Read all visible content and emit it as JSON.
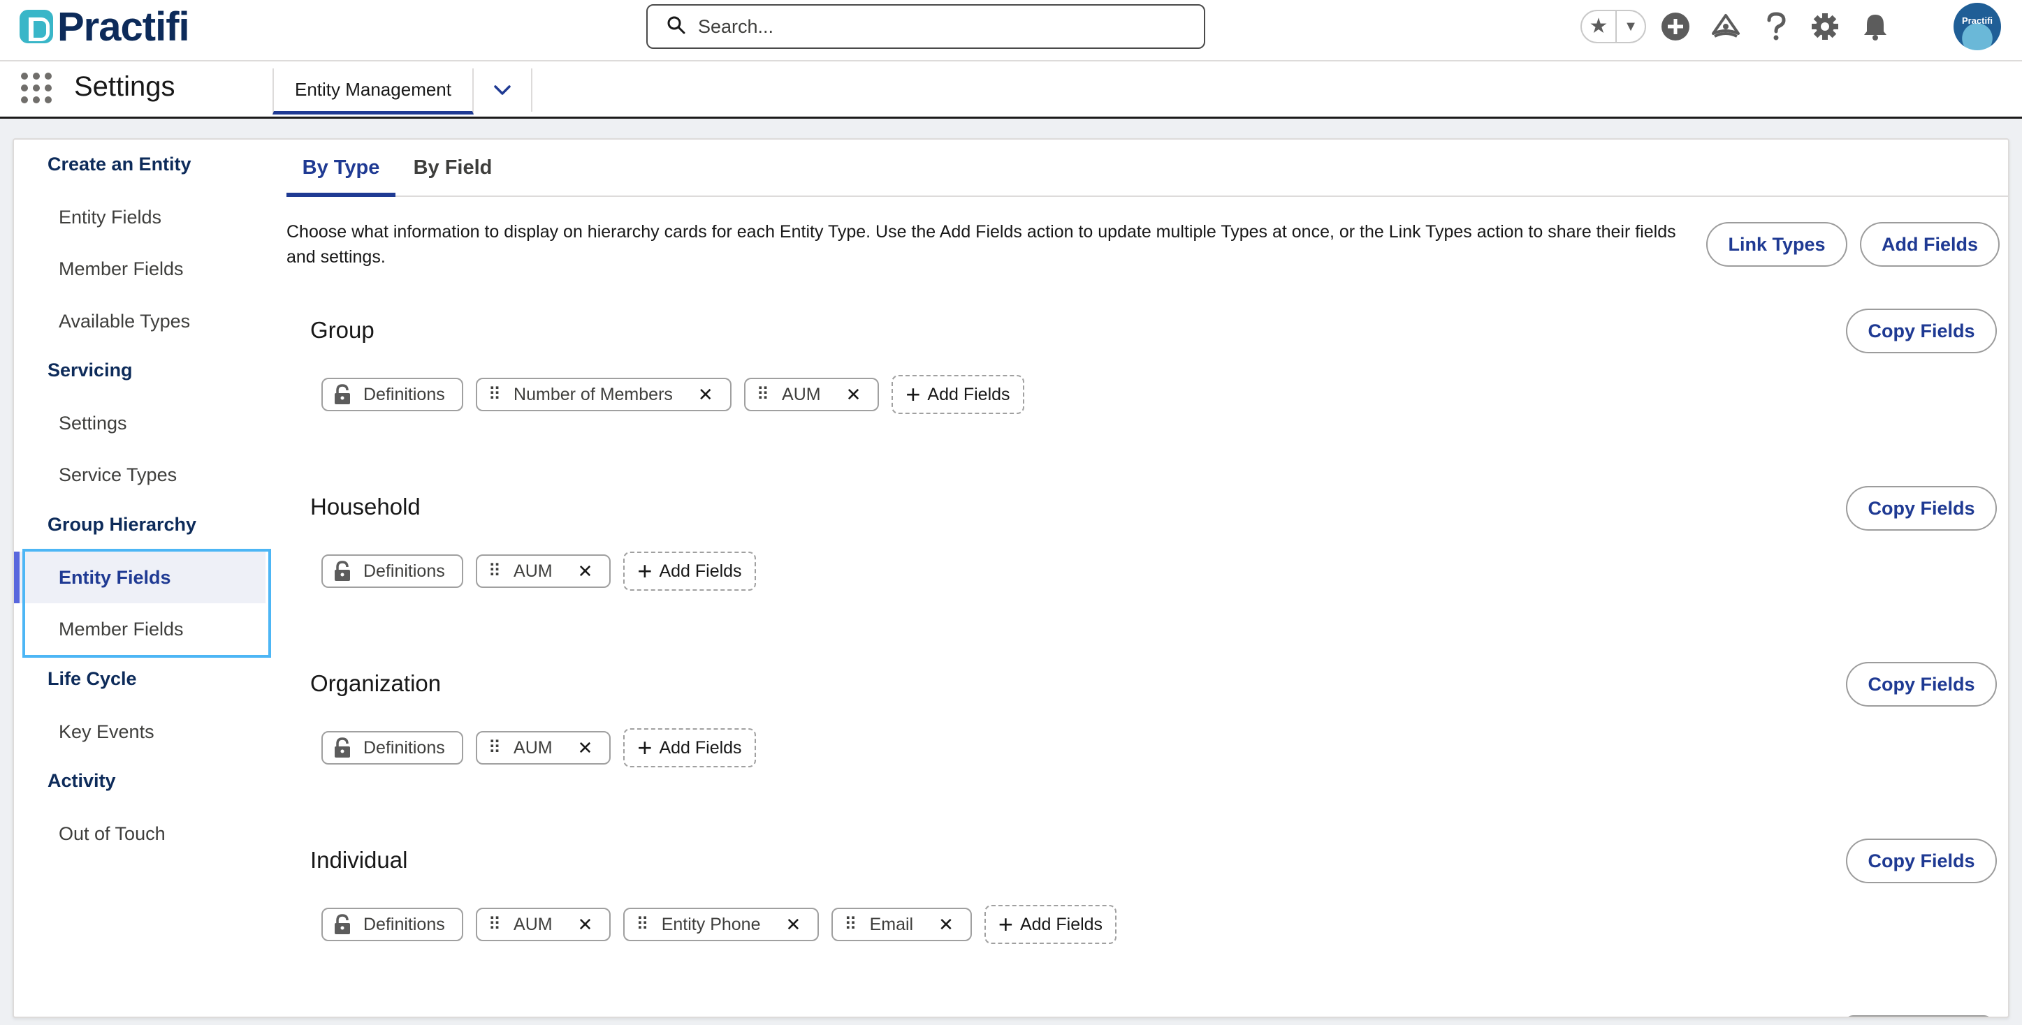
{
  "header": {
    "logo_text": "Practifi",
    "search_placeholder": "Search...",
    "avatar_text": "Practifi",
    "icons": [
      "star-icon",
      "chevron-down-icon",
      "add-icon",
      "trailhead-icon",
      "help-icon",
      "setup-gear-icon",
      "notification-bell-icon",
      "avatar"
    ]
  },
  "app_nav": {
    "app_title": "Settings",
    "tab_label": "Entity Management"
  },
  "sidebar": {
    "sections": [
      {
        "label": "Create an Entity",
        "items": [
          "Entity Fields",
          "Member Fields",
          "Available Types"
        ]
      },
      {
        "label": "Servicing",
        "items": [
          "Settings",
          "Service Types"
        ]
      },
      {
        "label": "Group Hierarchy",
        "items": [
          "Entity Fields",
          "Member Fields"
        ]
      },
      {
        "label": "Life Cycle",
        "items": [
          "Key Events"
        ]
      },
      {
        "label": "Activity",
        "items": [
          "Out of Touch"
        ]
      }
    ],
    "active_item": "Group Hierarchy / Entity Fields"
  },
  "main": {
    "tabs": [
      "By Type",
      "By Field"
    ],
    "active_tab": "By Type",
    "description": "Choose what information to display on hierarchy cards for each Entity Type. Use the Add Fields action to update multiple Types at once, or the Link Types action to share their fields and settings.",
    "link_types_label": "Link Types",
    "add_fields_label": "Add Fields",
    "copy_fields_label": "Copy Fields",
    "add_field_chip_label": "Add Fields",
    "entity_types": [
      {
        "name": "Group",
        "locked_chip": "Definitions",
        "fields": [
          "Number of Members",
          "AUM"
        ]
      },
      {
        "name": "Household",
        "locked_chip": "Definitions",
        "fields": [
          "AUM"
        ]
      },
      {
        "name": "Organization",
        "locked_chip": "Definitions",
        "fields": [
          "AUM"
        ]
      },
      {
        "name": "Individual",
        "locked_chip": "Definitions",
        "fields": [
          "AUM",
          "Entity Phone",
          "Email"
        ]
      }
    ]
  },
  "colors": {
    "brand_navy": "#0d2b5a",
    "brand_teal": "#39b6c8",
    "accent_blue": "#1f3a93",
    "active_bar": "#5867dd",
    "highlight": "#4db6f5"
  }
}
